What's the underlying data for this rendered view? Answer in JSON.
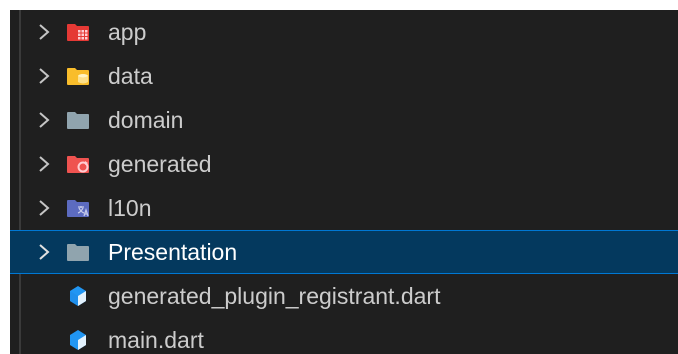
{
  "explorer": {
    "items": [
      {
        "label": "app",
        "kind": "folder",
        "icon": "app-folder-icon",
        "color": "#e53935",
        "expanded": false
      },
      {
        "label": "data",
        "kind": "folder",
        "icon": "data-folder-icon",
        "color": "#f9bd2b",
        "expanded": false
      },
      {
        "label": "domain",
        "kind": "folder",
        "icon": "folder-icon",
        "color": "#90a4ae",
        "expanded": false
      },
      {
        "label": "generated",
        "kind": "folder",
        "icon": "generated-folder-icon",
        "color": "#ef5350",
        "expanded": false
      },
      {
        "label": "l10n",
        "kind": "folder",
        "icon": "i18n-folder-icon",
        "color": "#5c6bc0",
        "expanded": false
      },
      {
        "label": "Presentation",
        "kind": "folder",
        "icon": "folder-icon",
        "color": "#90a4ae",
        "expanded": false,
        "selected": true
      },
      {
        "label": "generated_plugin_registrant.dart",
        "kind": "file",
        "icon": "dart-file-icon",
        "color": "#2196f3"
      },
      {
        "label": "main.dart",
        "kind": "file",
        "icon": "dart-file-icon",
        "color": "#2196f3"
      }
    ]
  }
}
